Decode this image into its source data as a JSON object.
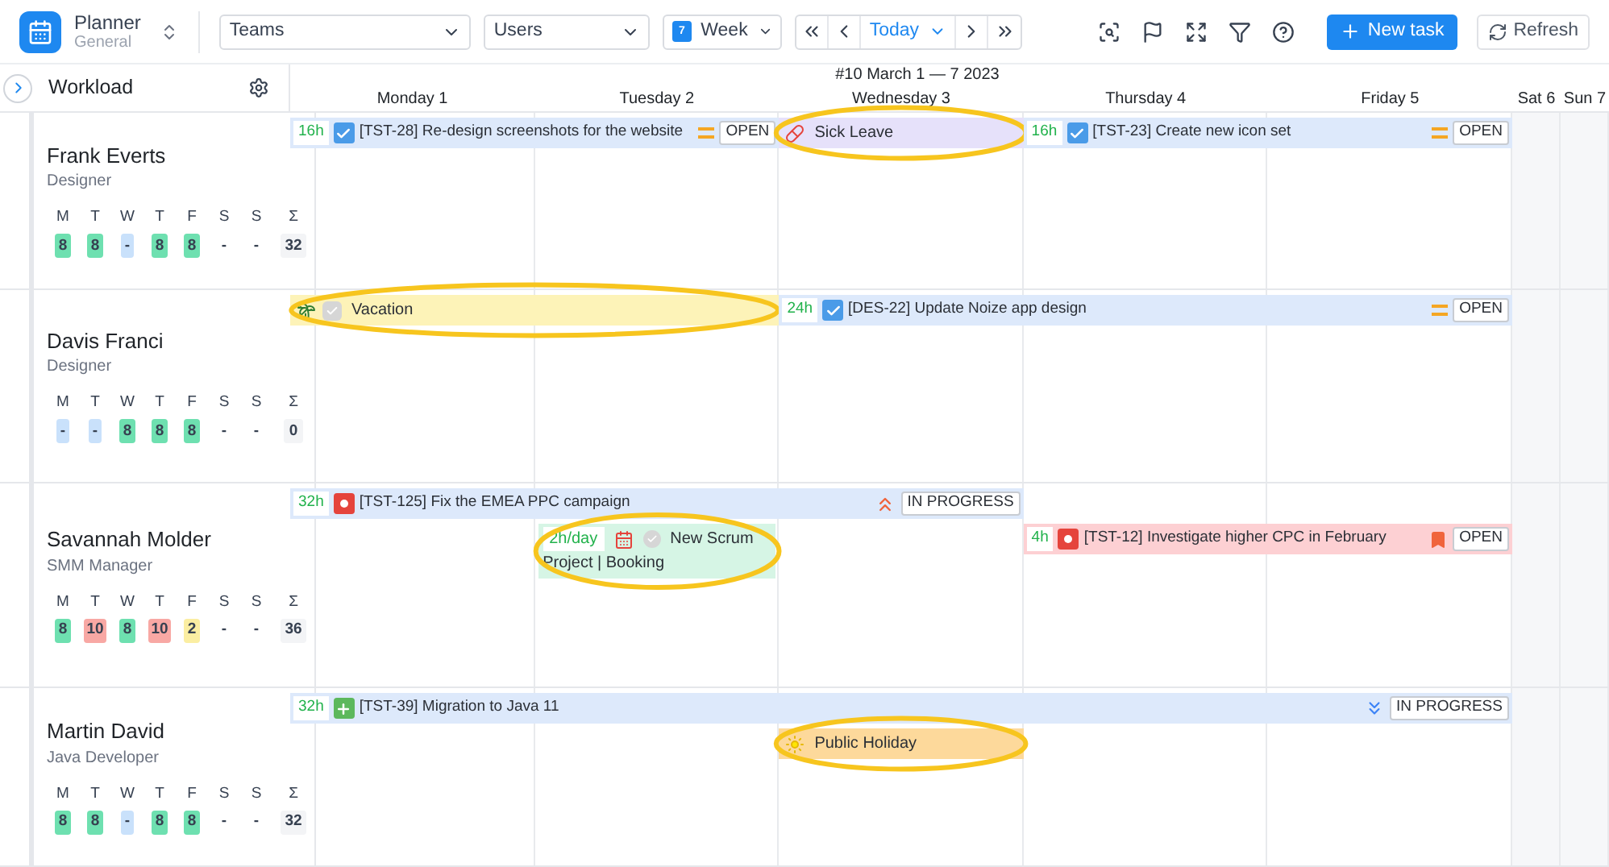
{
  "app": {
    "title": "Planner",
    "subtitle": "General",
    "week_icon_day": "7"
  },
  "toolbar": {
    "teams": "Teams",
    "users": "Users",
    "view": "Week",
    "today": "Today",
    "new_task": "New task",
    "refresh": "Refresh"
  },
  "panel": {
    "title": "Workload"
  },
  "week_label": "#10 March 1 — 7 2023",
  "days": [
    "Monday 1",
    "Tuesday 2",
    "Wednesday 3",
    "Thursday 4",
    "Friday 5",
    "Sat 6",
    "Sun 7"
  ],
  "people": [
    {
      "name": "Frank Everts",
      "role": "Designer",
      "day_letters": [
        "M",
        "T",
        "W",
        "T",
        "F",
        "S",
        "S",
        "Σ"
      ],
      "hours": [
        {
          "value": "8",
          "color": "#6ee0b0"
        },
        {
          "value": "8",
          "color": "#6ee0b0"
        },
        {
          "value": "-",
          "color": "#c9e1fb"
        },
        {
          "value": "8",
          "color": "#6ee0b0"
        },
        {
          "value": "8",
          "color": "#6ee0b0"
        },
        {
          "value": "-"
        },
        {
          "value": "-"
        }
      ],
      "total": "32",
      "events": [
        {
          "kind": "task",
          "hours": "16h",
          "type_icon": {
            "kind": "check"
          },
          "title": "[TST-28] Re-design screenshots for the website",
          "priority_icon": {
            "kind": "medium"
          },
          "status": "OPEN",
          "color": "#dde9fb"
        },
        {
          "kind": "absence",
          "icon": {
            "kind": "sick"
          },
          "label": "Sick Leave",
          "color": "#e6e1fa",
          "highlighted": true
        },
        {
          "kind": "task",
          "hours": "16h",
          "type_icon": {
            "kind": "check"
          },
          "title": "[TST-23] Create new icon set",
          "priority_icon": {
            "kind": "medium"
          },
          "status": "OPEN",
          "color": "#dde9fb"
        }
      ]
    },
    {
      "name": "Davis Franci",
      "role": "Designer",
      "day_letters": [
        "M",
        "T",
        "W",
        "T",
        "F",
        "S",
        "S",
        "Σ"
      ],
      "hours": [
        {
          "value": "-",
          "color": "#c9e1fb"
        },
        {
          "value": "-",
          "color": "#c9e1fb"
        },
        {
          "value": "8",
          "color": "#6ee0b0"
        },
        {
          "value": "8",
          "color": "#6ee0b0"
        },
        {
          "value": "8",
          "color": "#6ee0b0"
        },
        {
          "value": "-"
        },
        {
          "value": "-"
        }
      ],
      "total": "0",
      "events": [
        {
          "kind": "absence",
          "icon": {
            "kind": "vacation"
          },
          "label": "Vacation",
          "color": "#fdf3b8",
          "highlighted": true
        },
        {
          "kind": "task",
          "hours": "24h",
          "type_icon": {
            "kind": "check"
          },
          "title": "[DES-22] Update Noize app design",
          "priority_icon": {
            "kind": "medium"
          },
          "status": "OPEN",
          "color": "#dde9fb"
        }
      ]
    },
    {
      "name": "Savannah Molder",
      "role": "SMM Manager",
      "day_letters": [
        "M",
        "T",
        "W",
        "T",
        "F",
        "S",
        "S",
        "Σ"
      ],
      "hours": [
        {
          "value": "8",
          "color": "#6ee0b0"
        },
        {
          "value": "10",
          "color": "#f8a8a4"
        },
        {
          "value": "8",
          "color": "#6ee0b0"
        },
        {
          "value": "10",
          "color": "#f8a8a4"
        },
        {
          "value": "2",
          "color": "#fbeea2"
        },
        {
          "value": "-"
        },
        {
          "value": "-"
        }
      ],
      "total": "36",
      "events": [
        {
          "kind": "task",
          "hours": "32h",
          "type_icon": {
            "kind": "bug"
          },
          "title": "[TST-125] Fix the EMEA PPC campaign",
          "priority_icon": {
            "kind": "highest"
          },
          "status": "IN PROGRESS",
          "color": "#dde9fb"
        },
        {
          "kind": "meeting",
          "hours": "2h/day",
          "title": "New Scrum",
          "subtitle": "Project | Booking",
          "color": "#d6f5e5",
          "highlighted": true
        },
        {
          "kind": "task",
          "hours": "4h",
          "type_icon": {
            "kind": "bug"
          },
          "title": "[TST-12] Investigate higher CPC in February",
          "priority_icon": {
            "kind": "high"
          },
          "status": "OPEN",
          "color": "#fdd0d3"
        }
      ]
    },
    {
      "name": "Martin David",
      "role": "Java Developer",
      "day_letters": [
        "M",
        "T",
        "W",
        "T",
        "F",
        "S",
        "S",
        "Σ"
      ],
      "hours": [
        {
          "value": "8",
          "color": "#6ee0b0"
        },
        {
          "value": "8",
          "color": "#6ee0b0"
        },
        {
          "value": "-",
          "color": "#c9e1fb"
        },
        {
          "value": "8",
          "color": "#6ee0b0"
        },
        {
          "value": "8",
          "color": "#6ee0b0"
        },
        {
          "value": "-"
        },
        {
          "value": "-"
        }
      ],
      "total": "32",
      "events": [
        {
          "kind": "task",
          "hours": "32h",
          "type_icon": {
            "kind": "story"
          },
          "title": "[TST-39] Migration to Java 11",
          "priority_icon": {
            "kind": "lowest"
          },
          "status": "IN PROGRESS",
          "color": "#dde9fb"
        },
        {
          "kind": "absence",
          "icon": {
            "kind": "holiday"
          },
          "label": "Public Holiday",
          "color": "#fdd99b",
          "highlighted": true
        }
      ]
    }
  ]
}
